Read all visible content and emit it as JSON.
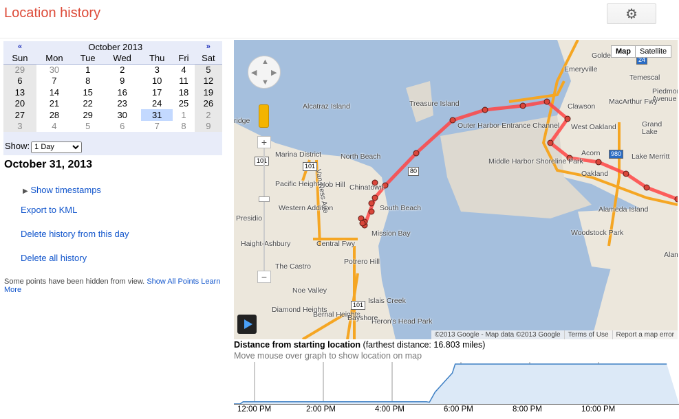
{
  "header": {
    "title": "Location history",
    "settings_icon": "gear-icon"
  },
  "calendar": {
    "month": "October 2013",
    "prev": "«",
    "next": "»",
    "weekdays": [
      "Sun",
      "Mon",
      "Tue",
      "Wed",
      "Thu",
      "Fri",
      "Sat"
    ],
    "weeks": [
      [
        "29",
        "30",
        "1",
        "2",
        "3",
        "4",
        "5"
      ],
      [
        "6",
        "7",
        "8",
        "9",
        "10",
        "11",
        "12"
      ],
      [
        "13",
        "14",
        "15",
        "16",
        "17",
        "18",
        "19"
      ],
      [
        "20",
        "21",
        "22",
        "23",
        "24",
        "25",
        "26"
      ],
      [
        "27",
        "28",
        "29",
        "30",
        "31",
        "1",
        "2"
      ],
      [
        "3",
        "4",
        "5",
        "6",
        "7",
        "8",
        "9"
      ]
    ],
    "selected": "31",
    "show_label": "Show:",
    "show_value": "1 Day"
  },
  "sidebar": {
    "date": "October 31, 2013",
    "show_timestamps": "Show timestamps",
    "export": "Export to KML",
    "delete_day": "Delete history from this day",
    "delete_all": "Delete all history",
    "note": "Some points have been hidden from view.",
    "show_all": "Show All Points",
    "learn_more": "Learn More"
  },
  "map": {
    "type_map": "Map",
    "type_satellite": "Satellite",
    "labels": [
      "Golden Gate",
      "Emeryville",
      "Temescal",
      "Piedmont Avenue",
      "MacArthur Fwy",
      "Clawson",
      "West Oakland",
      "Grand Lake",
      "Lake Merritt",
      "Acorn",
      "Treasure Island",
      "Alcatraz Island",
      "Outer Harbor Entrance Channel",
      "Middle Harbor Shoreline Park",
      "Marina District",
      "North Beach",
      "Pacific Heights",
      "Nob Hill",
      "Western Addition",
      "South Beach",
      "Mission Bay",
      "Central Fwy",
      "Haight-Ashbury",
      "The Castro",
      "Potrero Hill",
      "Noe Valley",
      "Diamond Heights",
      "Bernal Heights",
      "Islais Creek",
      "Heron's Head Park",
      "Alameda Island",
      "Woodstock Park",
      "Alam",
      "Presidio",
      "ridge",
      "Van Ness Ave",
      "Bayshore",
      "Oakland",
      "Chinatown"
    ],
    "shields": [
      "24",
      "980",
      "101",
      "101",
      "101",
      "80"
    ],
    "copyright": "©2013 Google - Map data ©2013 Google",
    "terms": "Terms of Use",
    "report": "Report a map error"
  },
  "graph": {
    "title": "Distance from starting location",
    "subtitle": "(farthest distance: 16.803 miles)",
    "hint": "Move mouse over graph to show location on map"
  },
  "chart_data": {
    "type": "area",
    "xlabel": "",
    "ylabel": "",
    "x_ticks": [
      "12:00 PM",
      "2:00 PM",
      "4:00 PM",
      "6:00 PM",
      "8:00 PM",
      "10:00 PM"
    ],
    "x": [
      "11:20",
      "11:35",
      "11:40",
      "17:00",
      "17:05",
      "17:15",
      "17:30",
      "17:45",
      "17:50",
      "23:59"
    ],
    "y": [
      0,
      0,
      0.9,
      0.9,
      0.7,
      5,
      9,
      13,
      16.803,
      16.803
    ],
    "ylim": [
      0,
      16.803
    ],
    "grid": "vertical",
    "fill": "#dce9f7",
    "line": "#3d7fc4"
  }
}
